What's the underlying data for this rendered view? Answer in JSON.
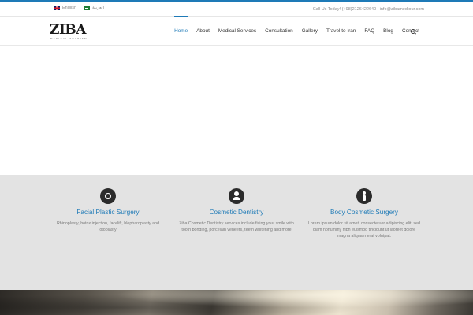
{
  "topbar": {
    "lang_english": "English",
    "lang_arabic": "العربية",
    "contact": "Call Us Today! (+98)2126422640 | info@zibamedtour.com"
  },
  "header": {
    "logo_text": "ZIBA",
    "logo_sub": "MEDICAL TOURISM",
    "nav": [
      "Home",
      "About",
      "Medical Services",
      "Consultation",
      "Gallery",
      "Travel to Iran",
      "FAQ",
      "Blog",
      "Contact"
    ],
    "active": "Home"
  },
  "services": [
    {
      "icon": "smiley-icon",
      "title": "Facial Plastic Surgery",
      "text": "Rhinoplasty, botox injection, facelift, blepharoplasty and otoplasty"
    },
    {
      "icon": "dentist-icon",
      "title": "Cosmetic Dentistry",
      "text": "Ziba Cosmetic Dentistry services include fixing your smile with tooth bonding, porcelain veneers, teeth whitening and more"
    },
    {
      "icon": "body-icon",
      "title": "Body Cosmetic Surgery",
      "text": "Lorem ipsum dolor sit amet, consectetuer adipiscing elit, sed diam nonummy nibh euismod tincidunt ut laoreet dolore magna aliquam erat volutpat."
    }
  ],
  "colors": {
    "accent": "#1e7ab7",
    "services_bg": "#e3e3e3",
    "icon_bg": "#2b2b2b"
  }
}
